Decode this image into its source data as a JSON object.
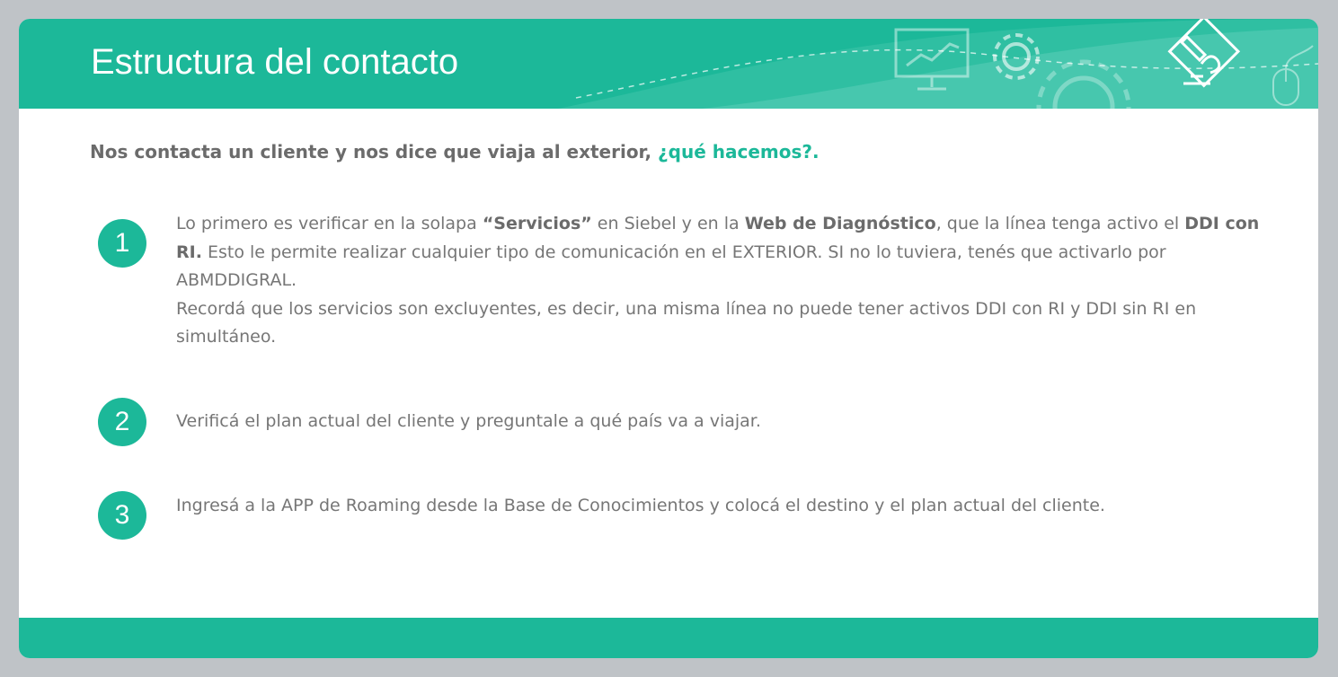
{
  "header": {
    "title": "Estructura del contacto"
  },
  "intro": {
    "question": "Nos contacta un cliente y nos dice que viaja al exterior, ",
    "accent": "¿qué hacemos?."
  },
  "steps": [
    {
      "number": "1",
      "line1_a": "Lo primero es verificar en la solapa ",
      "line1_b": "“Servicios”",
      "line1_c": " en Siebel y en la ",
      "line1_d": "Web de Diagnóstico",
      "line1_e": ", que la línea tenga activo el ",
      "line1_f": "DDI con RI.",
      "line1_g": " Esto le permite realizar cualquier tipo de comunicación en el EXTERIOR. SI no lo tuviera, tenés que activarlo por ABMDDIGRAL.",
      "line2": "Recordá que los servicios son excluyentes, es decir, una misma línea no puede tener activos DDI con RI y DDI sin RI en simultáneo."
    },
    {
      "number": "2",
      "text": "Verificá el plan actual del cliente y preguntale a qué país va a viajar."
    },
    {
      "number": "3",
      "text": "Ingresá a la APP de Roaming desde la Base de Conocimientos y colocá el destino y el plan actual del cliente."
    }
  ],
  "icons": [
    "monitor-chart-icon",
    "gear-icon",
    "large-gear-icon",
    "pencil-puzzle-icon",
    "mouse-icon"
  ],
  "colors": {
    "accent": "#1cb899",
    "text": "#767676",
    "frame": "#bfc3c7"
  }
}
